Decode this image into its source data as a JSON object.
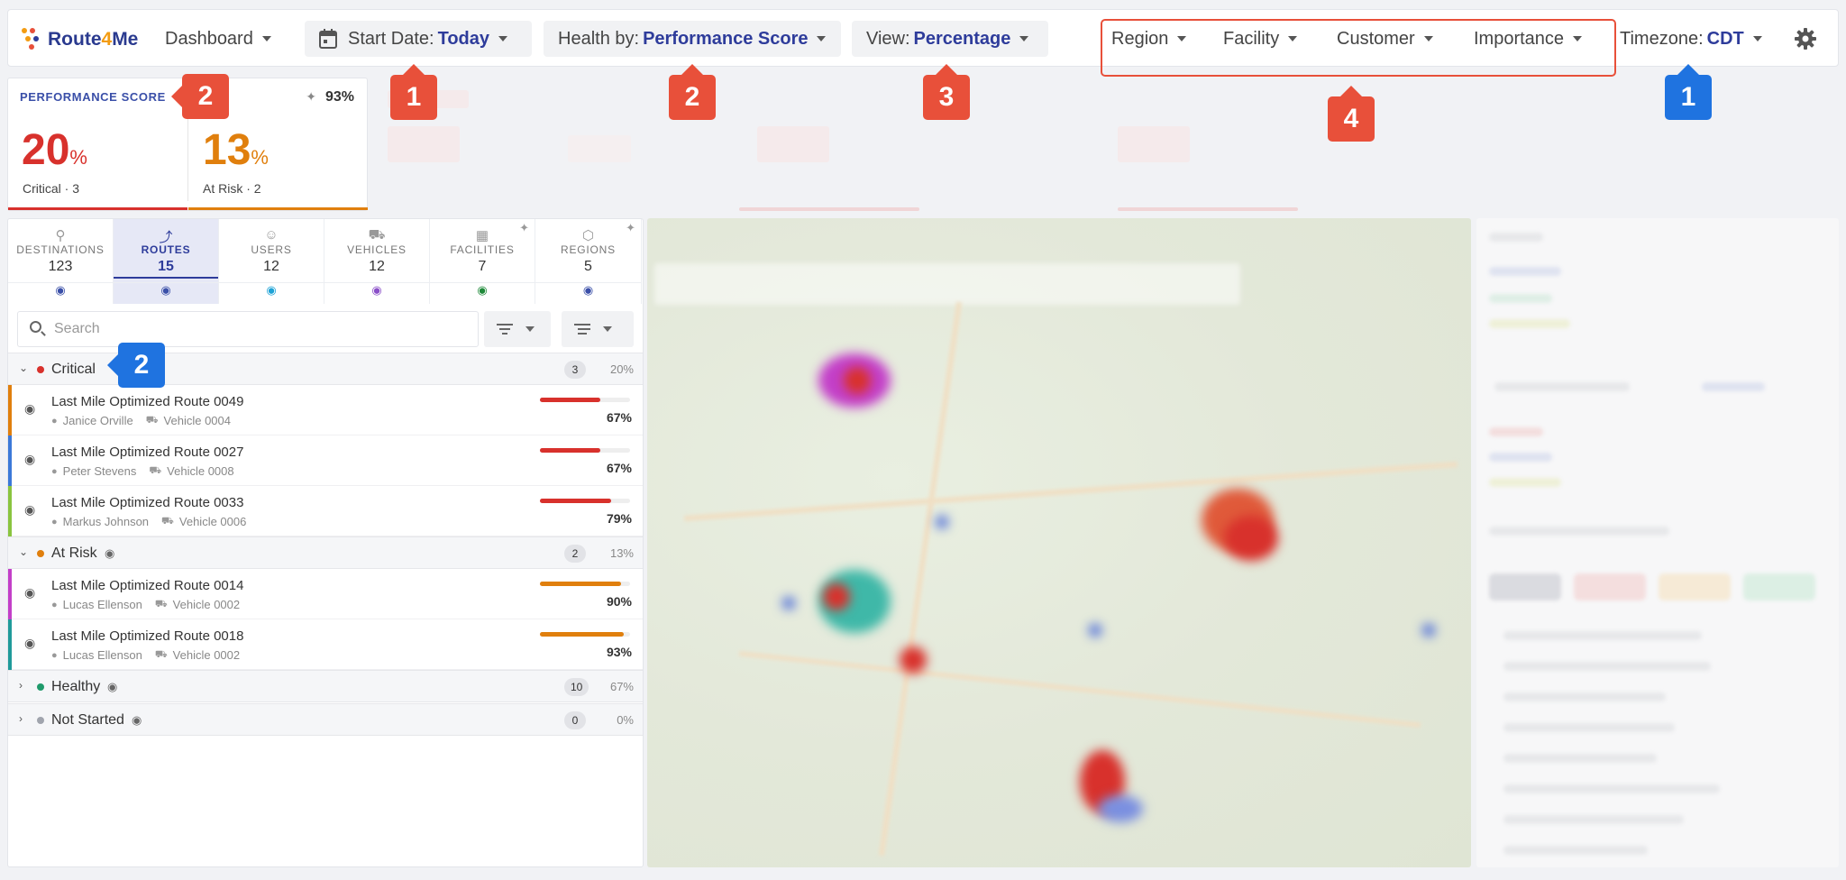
{
  "header": {
    "logo": {
      "pre": "Route",
      "num": "4",
      "post": "Me"
    },
    "dashboard": "Dashboard",
    "start_date": {
      "label": "Start Date:",
      "value": "Today"
    },
    "health_by": {
      "label": "Health by:",
      "value": "Performance Score"
    },
    "view": {
      "label": "View:",
      "value": "Percentage"
    },
    "filters": [
      "Region",
      "Facility",
      "Customer",
      "Importance"
    ],
    "timezone": {
      "label": "Timezone:",
      "value": "CDT"
    }
  },
  "performance": {
    "title": "PERFORMANCE SCORE",
    "overall": "93%",
    "critical": {
      "value": "20",
      "unit": "%",
      "label": "Critical · 3",
      "color": "#d8312c"
    },
    "at_risk": {
      "value": "13",
      "unit": "%",
      "label": "At Risk · 2",
      "color": "#e07f0d"
    }
  },
  "tabs": [
    {
      "name": "DESTINATIONS",
      "count": "123",
      "eye_color": "#3a4fa8"
    },
    {
      "name": "ROUTES",
      "count": "15",
      "eye_color": "#3a4fa8"
    },
    {
      "name": "USERS",
      "count": "12",
      "eye_color": "#1fa3d6"
    },
    {
      "name": "VEHICLES",
      "count": "12",
      "eye_color": "#8a4fc8"
    },
    {
      "name": "FACILITIES",
      "count": "7",
      "eye_color": "#1f8a3a"
    },
    {
      "name": "REGIONS",
      "count": "5",
      "eye_color": "#3a4fa8"
    }
  ],
  "search": {
    "placeholder": "Search"
  },
  "groups": {
    "critical": {
      "name": "Critical",
      "count": "3",
      "pct": "20%",
      "color": "#d8312c"
    },
    "at_risk": {
      "name": "At Risk",
      "count": "2",
      "pct": "13%",
      "color": "#e07f0d"
    },
    "healthy": {
      "name": "Healthy",
      "count": "10",
      "pct": "67%",
      "color": "#1f9a6b"
    },
    "not_started": {
      "name": "Not Started",
      "count": "0",
      "pct": "0%",
      "color": "#a0a4ad"
    }
  },
  "routes": [
    {
      "name": "Last Mile Optimized Route 0049",
      "user": "Janice Orville",
      "vehicle": "Vehicle 0004",
      "pct": "67%",
      "score": 0.67,
      "strip": "#e07f0d",
      "bar": "#d8312c"
    },
    {
      "name": "Last Mile Optimized Route 0027",
      "user": "Peter Stevens",
      "vehicle": "Vehicle 0008",
      "pct": "67%",
      "score": 0.67,
      "strip": "#3b78d8",
      "bar": "#d8312c"
    },
    {
      "name": "Last Mile Optimized Route 0033",
      "user": "Markus Johnson",
      "vehicle": "Vehicle 0006",
      "pct": "79%",
      "score": 0.79,
      "strip": "#8ac43f",
      "bar": "#d8312c"
    },
    {
      "name": "Last Mile Optimized Route 0014",
      "user": "Lucas Ellenson",
      "vehicle": "Vehicle 0002",
      "pct": "90%",
      "score": 0.9,
      "strip": "#c33fc8",
      "bar": "#e07f0d"
    },
    {
      "name": "Last Mile Optimized Route 0018",
      "user": "Lucas Ellenson",
      "vehicle": "Vehicle 0002",
      "pct": "93%",
      "score": 0.93,
      "strip": "#1f9a9a",
      "bar": "#e07f0d"
    }
  ],
  "callouts": [
    "1",
    "2",
    "3",
    "4",
    "1",
    "2",
    "2"
  ]
}
